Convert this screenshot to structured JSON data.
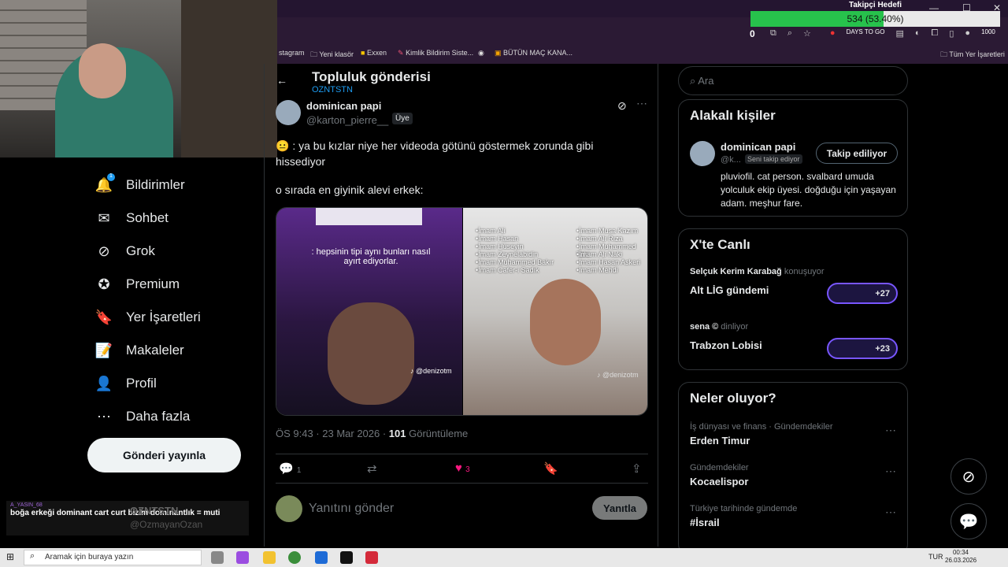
{
  "browser": {
    "minimize": "—",
    "maximize": "☐",
    "close": "✕",
    "goal_title": "Takipçi Hedefi",
    "goal_text": "534 (53.40%)",
    "goal_fraction": 0.534,
    "goal_zero": "0",
    "days_label": "DAYS TO GO",
    "counter": "1000"
  },
  "bookmarks": [
    "stagram",
    "Yeni klasör",
    "Exxen",
    "Kimlik Bildirim Siste...",
    "",
    "BÜTÜN MAÇ KANA...",
    "Tüm Yer İşaretleri"
  ],
  "nav": {
    "items": [
      {
        "label": "Bildirimler",
        "icon": "bell-icon",
        "glyph": "🔔"
      },
      {
        "label": "Sohbet",
        "icon": "mail-icon",
        "glyph": "✉"
      },
      {
        "label": "Grok",
        "icon": "grok-icon",
        "glyph": "⊘"
      },
      {
        "label": "Premium",
        "icon": "verified-icon",
        "glyph": "✪"
      },
      {
        "label": "Yer İşaretleri",
        "icon": "bookmark-icon",
        "glyph": "🔖"
      },
      {
        "label": "Makaleler",
        "icon": "article-icon",
        "glyph": "📝"
      },
      {
        "label": "Profil",
        "icon": "profile-icon",
        "glyph": "👤"
      },
      {
        "label": "Daha fazla",
        "icon": "more-icon",
        "glyph": "⋯"
      }
    ],
    "notif_badge": "1",
    "post_button": "Gönderi yayınla"
  },
  "chat": {
    "user": "A_YASIN_68",
    "message": "boğa erkeği dominant cart curt bizim dominantlık = muti",
    "account_name": "OZNTSTN",
    "account_handle": "@OzmayanOzan"
  },
  "post": {
    "header_title": "Topluluk gönderisi",
    "header_sub": "OZNTSTN",
    "author": "dominican papi",
    "handle": "@karton_pierre__",
    "badge": "Üye",
    "text1": "😐 : ya bu kızlar niye her videoda götünü göstermek zorunda gibi hissediyor",
    "text2": "o sırada en giyinik alevi erkek:",
    "media_caption": ": hepsinin tipi aynı bunları nasıl ayırt ediyorlar.",
    "tiktok1": "♪ @denizotm",
    "tiktok2": "♪ @denizotm",
    "imams_left": [
      "•İmam Ali",
      "•İmam Hasan",
      "•İmam Hüseyin",
      "•İmam Zeynelabidin",
      "•İmam Muhammed Bakır",
      "•İmam Cafer-i Sadık"
    ],
    "imams_right": [
      "•İmam Musa Kazım",
      "•İmam Ali Rıza",
      "•İmam Muhammed Taki",
      "•İmam Ali Naki",
      "•İmam Hasan Askeri",
      "•İmam Mehdi"
    ],
    "time": "ÖS 9:43 · 23 Mar 2026 · ",
    "views_count": "101",
    "views_label": " Görüntüleme",
    "replies": "1",
    "likes": "3",
    "reply_placeholder": "Yanıtını gönder",
    "reply_button": "Yanıtla"
  },
  "right": {
    "search_placeholder": "Ara",
    "related_title": "Alakalı kişiler",
    "related_name": "dominican papi",
    "related_handle": "@k...",
    "follows_you": "Seni takip ediyor",
    "following_button": "Takip ediliyor",
    "bio": "pluviofil. cat person. svalbard umuda yolculuk ekip üyesi. doğduğu için yaşayan adam. meşhur fare.",
    "live_title": "X'te Canlı",
    "lives": [
      {
        "host": "Selçuk Kerim Karabağ",
        "status": " konuşuyor",
        "title": "Alt LİG gündemi",
        "count": "+27"
      },
      {
        "host": "sena ©",
        "status": " dinliyor",
        "title": "Trabzon Lobisi",
        "count": "+23"
      }
    ],
    "trends_title": "Neler oluyor?",
    "trends": [
      {
        "category": "İş dünyası ve finans · Gündemdekiler",
        "name": "Erden Timur"
      },
      {
        "category": "Gündemdekiler",
        "name": "Kocaelispor"
      },
      {
        "category": "Türkiye tarihinde gündemde",
        "name": "#İsrail"
      }
    ]
  },
  "taskbar": {
    "search": "Aramak için buraya yazın",
    "lang": "TUR",
    "time": "00:34",
    "date": "26.03.2026"
  }
}
